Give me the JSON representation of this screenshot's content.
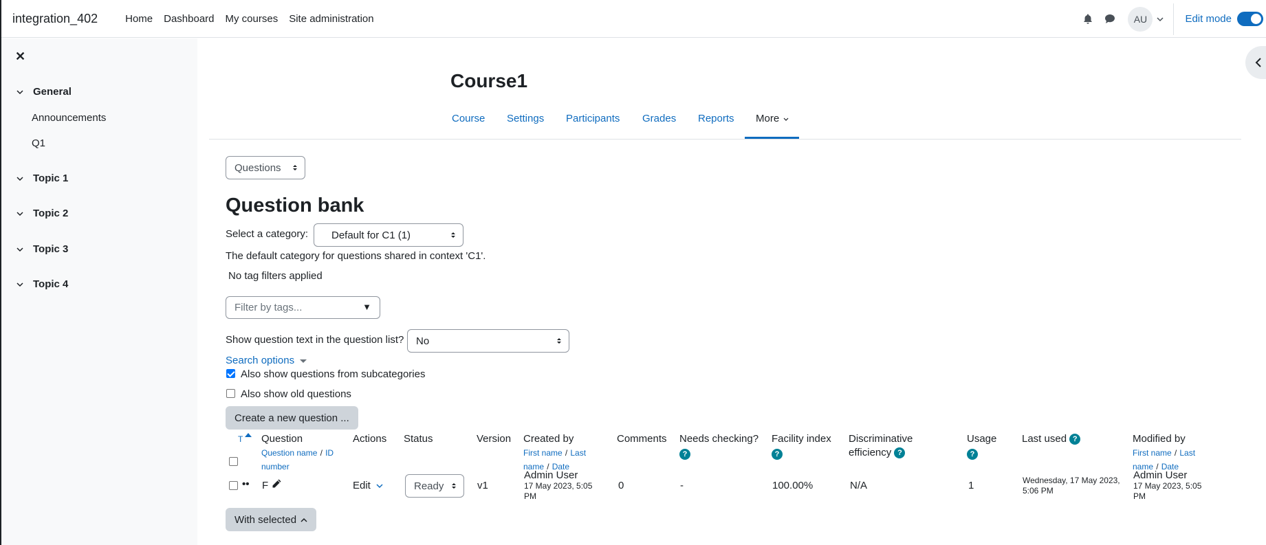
{
  "navbar": {
    "brand": "integration_402",
    "links": [
      "Home",
      "Dashboard",
      "My courses",
      "Site administration"
    ],
    "avatar_initials": "AU",
    "edit_mode_label": "Edit mode",
    "edit_mode_on": true
  },
  "drawer": {
    "sections": [
      "General",
      "Topic 1",
      "Topic 2",
      "Topic 3",
      "Topic 4"
    ],
    "general_items": [
      "Announcements",
      "Q1"
    ]
  },
  "course": {
    "title": "Course1",
    "tabs": [
      "Course",
      "Settings",
      "Participants",
      "Grades",
      "Reports",
      "More"
    ],
    "active_tab": "More"
  },
  "page": {
    "nav_select_value": "Questions",
    "heading": "Question bank",
    "category_label": "Select a category:",
    "category_value": "Default for C1 (1)",
    "category_info": "The default category for questions shared in context 'C1'.",
    "tag_status": "No tag filters applied",
    "tag_filter_placeholder": "Filter by tags...",
    "show_text_label": "Show question text in the question list?",
    "show_text_value": "No",
    "search_options_label": "Search options",
    "subcategories_label": "Also show questions from subcategories",
    "subcategories_checked": true,
    "old_questions_label": "Also show old questions",
    "old_questions_checked": false,
    "create_button": "Create a new question ...",
    "with_selected_button": "With selected"
  },
  "table": {
    "type_header": "T",
    "headers": {
      "question": "Question",
      "question_sub1": "Question name",
      "question_sub2": "ID number",
      "actions": "Actions",
      "status": "Status",
      "version": "Version",
      "created_by": "Created by",
      "created_sub1": "First name",
      "created_sub2": "Last name",
      "created_sub3": "Date",
      "comments": "Comments",
      "needs_checking_1": "Needs checking?",
      "facility_index": "Facility index",
      "disc_eff_1": "Discriminative",
      "disc_eff_2": "efficiency",
      "usage": "Usage",
      "last_used": "Last used",
      "modified_by": "Modified by",
      "modified_sub1": "First name",
      "modified_sub2": "Last name",
      "modified_sub3": "Date",
      "sep": "/",
      "help_glyph": "?"
    },
    "rows": [
      {
        "question_name": "F",
        "action": "Edit",
        "status": "Ready",
        "version": "v1",
        "created_by_name": "Admin User",
        "created_date_1": "17 May 2023, 5:05",
        "created_date_2": "PM",
        "comments": "0",
        "needs_checking": "-",
        "facility_index": "100.00%",
        "disc_eff": "N/A",
        "usage": "1",
        "last_used_1": "Wednesday, 17 May 2023,",
        "last_used_2": "5:06 PM",
        "modified_by_name": "Admin User",
        "modified_date_1": "17 May 2023, 5:05",
        "modified_date_2": "PM"
      }
    ]
  }
}
